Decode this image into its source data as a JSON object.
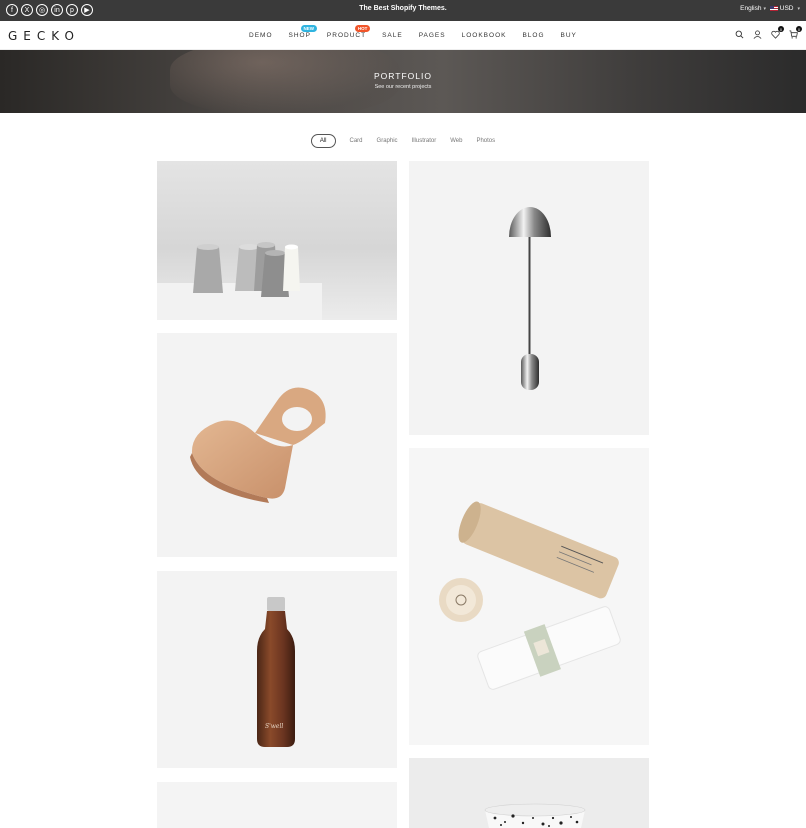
{
  "topbar": {
    "social_icons": [
      "facebook-icon",
      "x-icon",
      "instagram-icon",
      "linkedin-icon",
      "pinterest-icon",
      "youtube-icon"
    ],
    "promo": "The Best Shopify Themes.",
    "language": "English",
    "currency": "USD"
  },
  "header": {
    "logo": "GECKO",
    "nav": [
      {
        "label": "DEMO"
      },
      {
        "label": "SHOP",
        "badge": "NEW"
      },
      {
        "label": "PRODUCT",
        "badge": "HOT"
      },
      {
        "label": "SALE"
      },
      {
        "label": "PAGES"
      },
      {
        "label": "LOOKBOOK"
      },
      {
        "label": "BLOG"
      },
      {
        "label": "BUY"
      }
    ],
    "wishlist_count": "0",
    "cart_count": "0"
  },
  "banner": {
    "title": "PORTFOLIO",
    "subtitle": "See our recent projects"
  },
  "filters": [
    "All",
    "Card",
    "Graphic",
    "Illustrator",
    "Web",
    "Photos"
  ],
  "active_filter": "All",
  "portfolio": {
    "bottle_brand": "S'well"
  },
  "colors": {
    "topbar_bg": "#3a3a3a",
    "badge_new": "#2fb4e0",
    "badge_hot": "#f1552a"
  }
}
